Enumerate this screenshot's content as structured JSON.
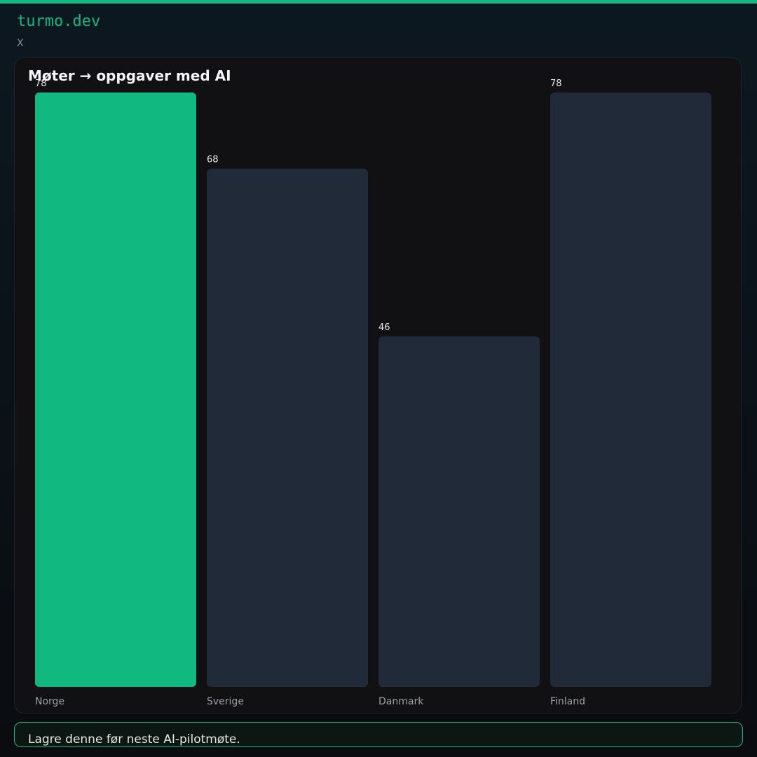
{
  "header": {
    "brand": "turmo.dev",
    "platform": "X"
  },
  "colors": {
    "accent": "#11b981",
    "bar_default": "#212a39",
    "card_bg": "#111114"
  },
  "chart_data": {
    "type": "bar",
    "title": "Møter → oppgaver med AI",
    "categories": [
      "Norge",
      "Sverige",
      "Danmark",
      "Finland"
    ],
    "values": [
      78,
      68,
      46,
      78
    ],
    "data_labels": [
      "78",
      "68",
      "46",
      "78"
    ],
    "highlight_index": 0,
    "ylim": [
      0,
      78
    ],
    "xlabel": "",
    "ylabel": "",
    "grid": false,
    "legend": "none"
  },
  "footer": {
    "note": "Lagre denne før neste AI-pilotmøte."
  }
}
